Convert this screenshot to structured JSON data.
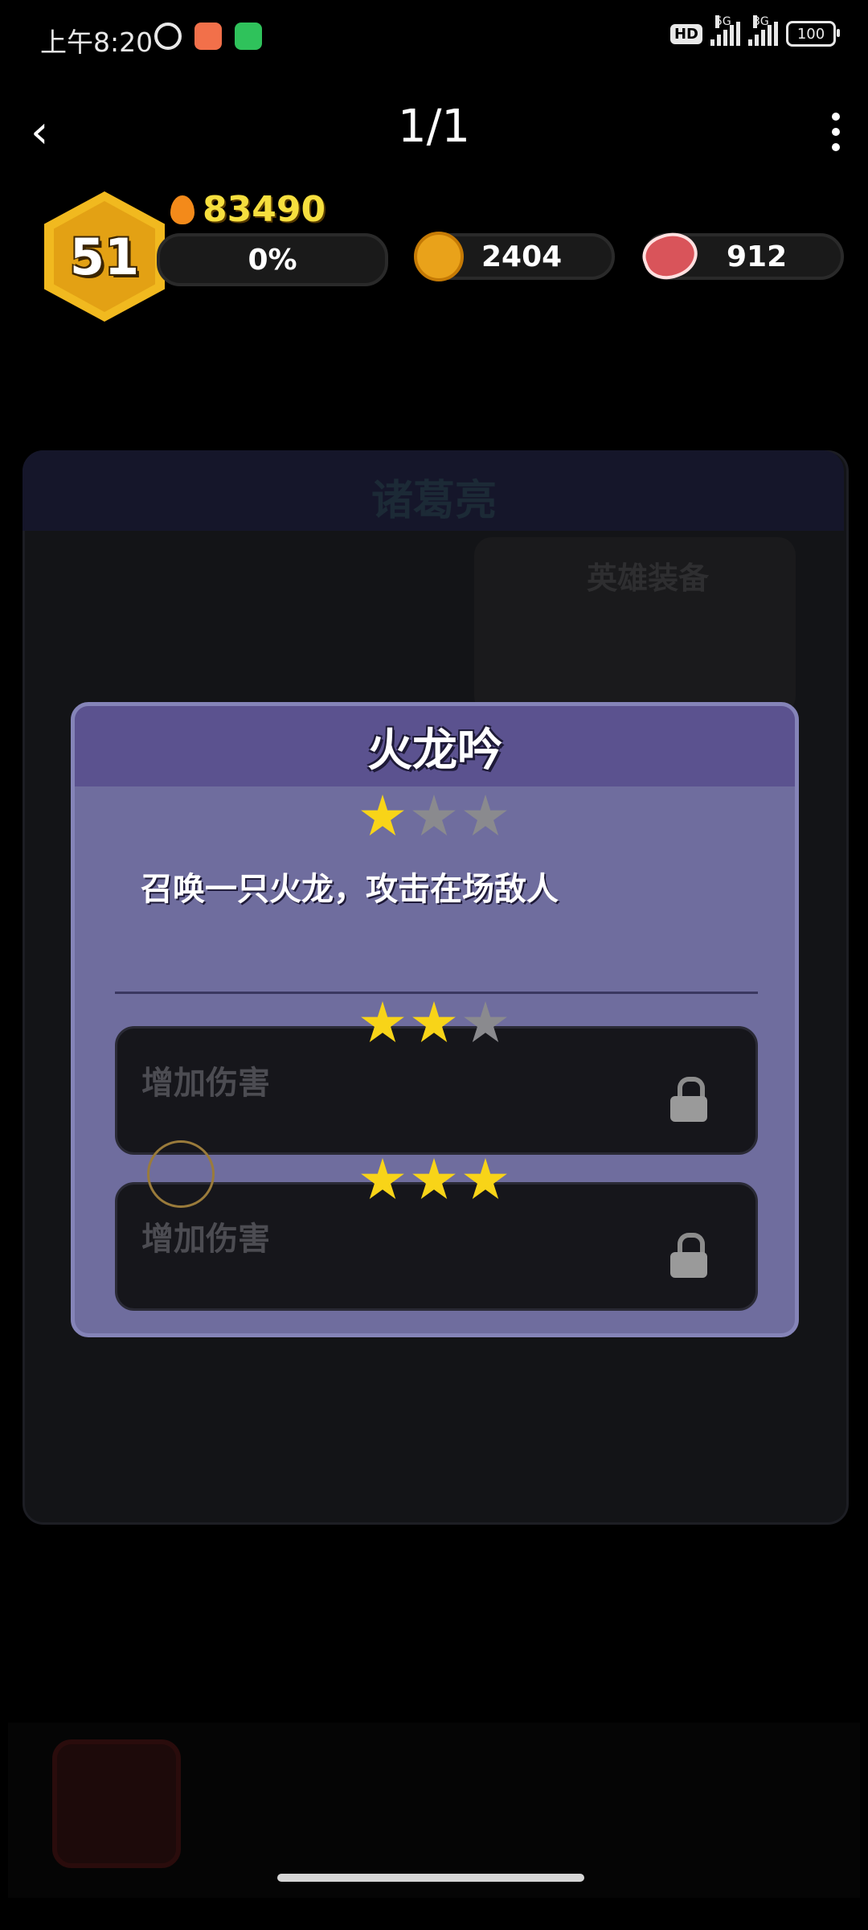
{
  "status_bar": {
    "time": "上午8:20",
    "signal_1": "5G",
    "signal_2": "3G",
    "hd": "HD",
    "battery": "100"
  },
  "nav": {
    "back_glyph": "‹",
    "title": "1/1"
  },
  "player": {
    "level": "51",
    "power": "83490",
    "progress": "0%",
    "coins": "2404",
    "meat": "912"
  },
  "background": {
    "hero_name": "诸葛亮",
    "equip_label": "英雄装备"
  },
  "modal": {
    "title": "火龙吟",
    "current_stars": 1,
    "max_stars": 3,
    "description": "召唤一只火龙，攻击在场敌人",
    "upgrades": [
      {
        "stars": 2,
        "label": "增加伤害",
        "locked": true
      },
      {
        "stars": 3,
        "label": "增加伤害",
        "locked": true
      }
    ]
  },
  "colors": {
    "gold": "#f6df3e",
    "modal_bg": "#6f6d9e",
    "modal_header": "#5b528f",
    "star_on": "#f8d418",
    "star_off": "#8a8a8e"
  }
}
